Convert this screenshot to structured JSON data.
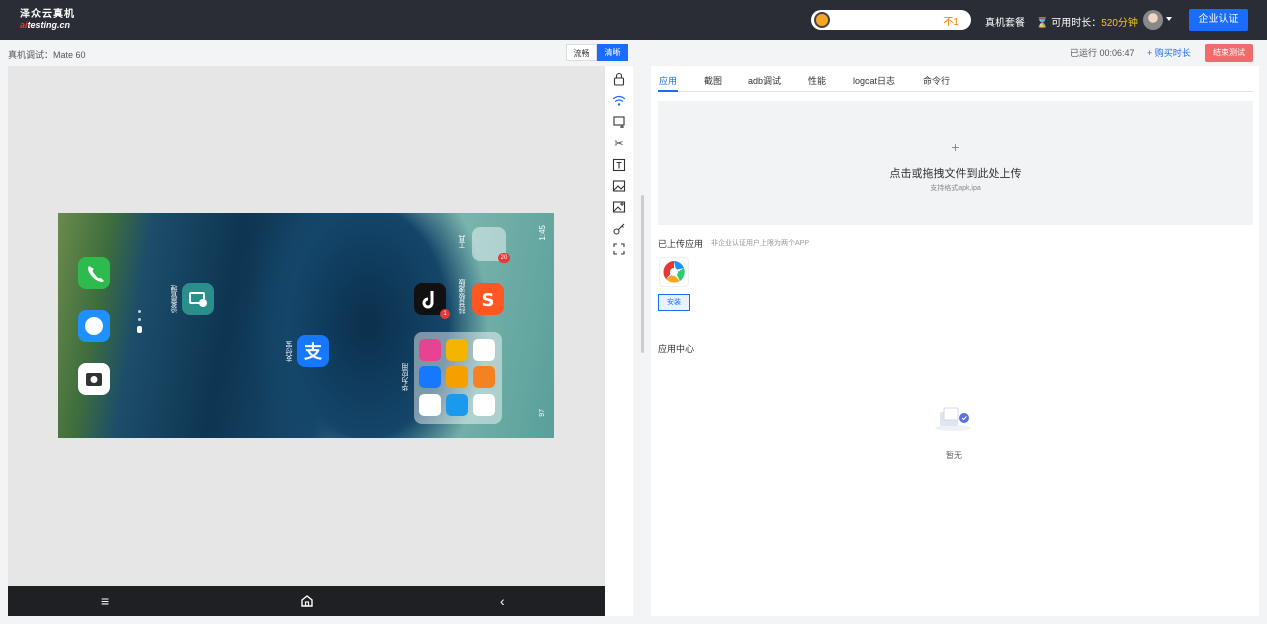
{
  "header": {
    "logo_line1": "泽众云真机",
    "logo_line2_prefix": "ai",
    "logo_line2_suffix": "testing.cn",
    "search_tag": "不1",
    "plans_link": "真机套餐",
    "time_label": "可用时长：",
    "time_value": "520分钟",
    "enterprise_button": "企业认证"
  },
  "device": {
    "title": "真机调试：Mate 60",
    "quality_options": [
      "流畅",
      "清晰"
    ],
    "selected_quality": "清晰",
    "status_time": "1:45",
    "battery": "97",
    "home_labels": {
      "tools": "工具",
      "huawei_app": "华为应用",
      "alipay": "支付宝",
      "douyin_folder": "抖音极速版",
      "recommended": "精品推荐",
      "device_manage": "设备管理"
    },
    "badges": {
      "tools": "20",
      "douyin": "1"
    }
  },
  "toolbar_icons": [
    "lock-icon",
    "wifi-icon",
    "screen-icon",
    "scissors-icon",
    "text-icon",
    "image-icon",
    "image-edit-icon",
    "key-icon",
    "fullscreen-icon"
  ],
  "right": {
    "running": "已运行 00:06:47",
    "buy_time": "+ 购买时长",
    "end_test": "结束测试",
    "tabs": [
      "应用",
      "截图",
      "adb调试",
      "性能",
      "logcat日志",
      "命令行"
    ],
    "active_tab": "应用",
    "upload_plus": "+",
    "upload_main": "点击或拖拽文件到此处上传",
    "upload_hint": "支持格式apk,ipa",
    "uploaded_title": "已上传应用",
    "uploaded_note": "非企业认证用户上限为两个APP",
    "install_button": "安装",
    "app_center_title": "应用中心",
    "empty_text": "暂无"
  }
}
